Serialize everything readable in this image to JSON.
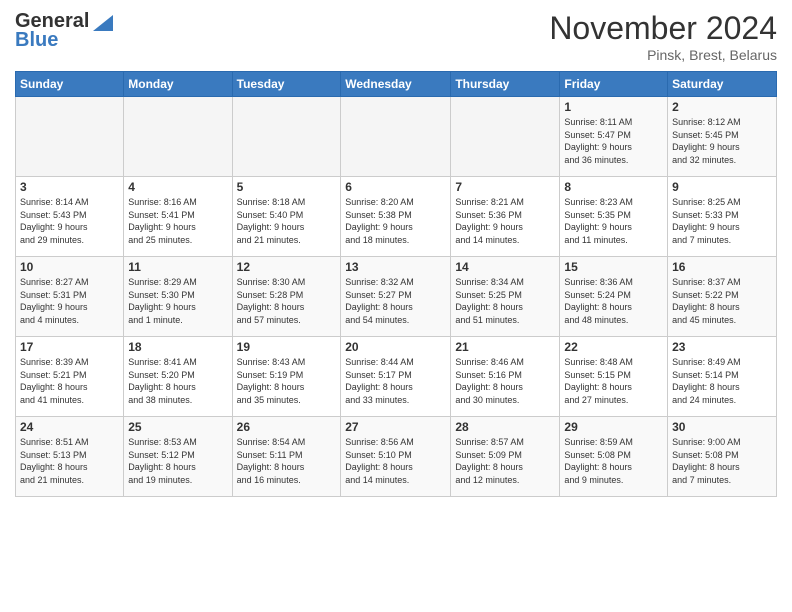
{
  "header": {
    "logo": {
      "line1": "General",
      "line2": "Blue"
    },
    "month": "November 2024",
    "location": "Pinsk, Brest, Belarus"
  },
  "weekdays": [
    "Sunday",
    "Monday",
    "Tuesday",
    "Wednesday",
    "Thursday",
    "Friday",
    "Saturday"
  ],
  "weeks": [
    [
      {
        "day": "",
        "info": ""
      },
      {
        "day": "",
        "info": ""
      },
      {
        "day": "",
        "info": ""
      },
      {
        "day": "",
        "info": ""
      },
      {
        "day": "",
        "info": ""
      },
      {
        "day": "1",
        "info": "Sunrise: 8:11 AM\nSunset: 5:47 PM\nDaylight: 9 hours\nand 36 minutes."
      },
      {
        "day": "2",
        "info": "Sunrise: 8:12 AM\nSunset: 5:45 PM\nDaylight: 9 hours\nand 32 minutes."
      }
    ],
    [
      {
        "day": "3",
        "info": "Sunrise: 8:14 AM\nSunset: 5:43 PM\nDaylight: 9 hours\nand 29 minutes."
      },
      {
        "day": "4",
        "info": "Sunrise: 8:16 AM\nSunset: 5:41 PM\nDaylight: 9 hours\nand 25 minutes."
      },
      {
        "day": "5",
        "info": "Sunrise: 8:18 AM\nSunset: 5:40 PM\nDaylight: 9 hours\nand 21 minutes."
      },
      {
        "day": "6",
        "info": "Sunrise: 8:20 AM\nSunset: 5:38 PM\nDaylight: 9 hours\nand 18 minutes."
      },
      {
        "day": "7",
        "info": "Sunrise: 8:21 AM\nSunset: 5:36 PM\nDaylight: 9 hours\nand 14 minutes."
      },
      {
        "day": "8",
        "info": "Sunrise: 8:23 AM\nSunset: 5:35 PM\nDaylight: 9 hours\nand 11 minutes."
      },
      {
        "day": "9",
        "info": "Sunrise: 8:25 AM\nSunset: 5:33 PM\nDaylight: 9 hours\nand 7 minutes."
      }
    ],
    [
      {
        "day": "10",
        "info": "Sunrise: 8:27 AM\nSunset: 5:31 PM\nDaylight: 9 hours\nand 4 minutes."
      },
      {
        "day": "11",
        "info": "Sunrise: 8:29 AM\nSunset: 5:30 PM\nDaylight: 9 hours\nand 1 minute."
      },
      {
        "day": "12",
        "info": "Sunrise: 8:30 AM\nSunset: 5:28 PM\nDaylight: 8 hours\nand 57 minutes."
      },
      {
        "day": "13",
        "info": "Sunrise: 8:32 AM\nSunset: 5:27 PM\nDaylight: 8 hours\nand 54 minutes."
      },
      {
        "day": "14",
        "info": "Sunrise: 8:34 AM\nSunset: 5:25 PM\nDaylight: 8 hours\nand 51 minutes."
      },
      {
        "day": "15",
        "info": "Sunrise: 8:36 AM\nSunset: 5:24 PM\nDaylight: 8 hours\nand 48 minutes."
      },
      {
        "day": "16",
        "info": "Sunrise: 8:37 AM\nSunset: 5:22 PM\nDaylight: 8 hours\nand 45 minutes."
      }
    ],
    [
      {
        "day": "17",
        "info": "Sunrise: 8:39 AM\nSunset: 5:21 PM\nDaylight: 8 hours\nand 41 minutes."
      },
      {
        "day": "18",
        "info": "Sunrise: 8:41 AM\nSunset: 5:20 PM\nDaylight: 8 hours\nand 38 minutes."
      },
      {
        "day": "19",
        "info": "Sunrise: 8:43 AM\nSunset: 5:19 PM\nDaylight: 8 hours\nand 35 minutes."
      },
      {
        "day": "20",
        "info": "Sunrise: 8:44 AM\nSunset: 5:17 PM\nDaylight: 8 hours\nand 33 minutes."
      },
      {
        "day": "21",
        "info": "Sunrise: 8:46 AM\nSunset: 5:16 PM\nDaylight: 8 hours\nand 30 minutes."
      },
      {
        "day": "22",
        "info": "Sunrise: 8:48 AM\nSunset: 5:15 PM\nDaylight: 8 hours\nand 27 minutes."
      },
      {
        "day": "23",
        "info": "Sunrise: 8:49 AM\nSunset: 5:14 PM\nDaylight: 8 hours\nand 24 minutes."
      }
    ],
    [
      {
        "day": "24",
        "info": "Sunrise: 8:51 AM\nSunset: 5:13 PM\nDaylight: 8 hours\nand 21 minutes."
      },
      {
        "day": "25",
        "info": "Sunrise: 8:53 AM\nSunset: 5:12 PM\nDaylight: 8 hours\nand 19 minutes."
      },
      {
        "day": "26",
        "info": "Sunrise: 8:54 AM\nSunset: 5:11 PM\nDaylight: 8 hours\nand 16 minutes."
      },
      {
        "day": "27",
        "info": "Sunrise: 8:56 AM\nSunset: 5:10 PM\nDaylight: 8 hours\nand 14 minutes."
      },
      {
        "day": "28",
        "info": "Sunrise: 8:57 AM\nSunset: 5:09 PM\nDaylight: 8 hours\nand 12 minutes."
      },
      {
        "day": "29",
        "info": "Sunrise: 8:59 AM\nSunset: 5:08 PM\nDaylight: 8 hours\nand 9 minutes."
      },
      {
        "day": "30",
        "info": "Sunrise: 9:00 AM\nSunset: 5:08 PM\nDaylight: 8 hours\nand 7 minutes."
      }
    ]
  ]
}
